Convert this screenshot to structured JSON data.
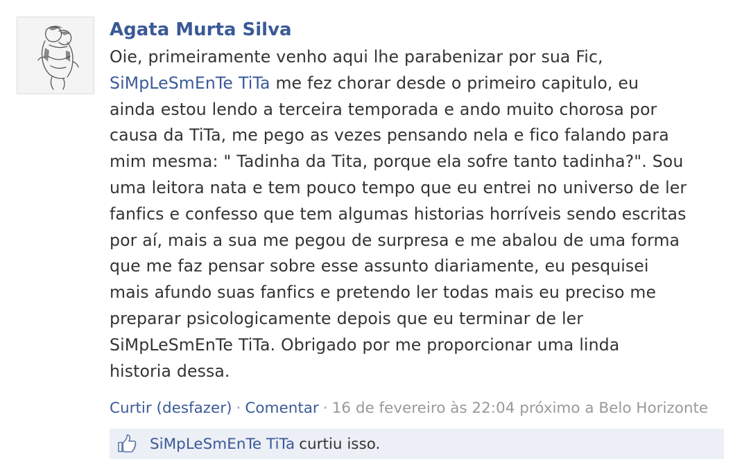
{
  "post": {
    "author": "Agata Murta Silva",
    "avatar_icon": "sketch-couple-hug-avatar",
    "message_lines": [
      [
        {
          "t": "Oie, primeiramente venho aqui lhe parabenizar por sua Fic,"
        }
      ],
      [
        {
          "t": "SiMpLeSmEnTe TiTa",
          "link": true
        },
        {
          "t": " me fez chorar desde o primeiro capitulo, eu"
        }
      ],
      [
        {
          "t": "ainda estou lendo a terceira temporada e ando muito chorosa por"
        }
      ],
      [
        {
          "t": "causa da TiTa, me pego as vezes pensando nela e fico falando para"
        }
      ],
      [
        {
          "t": "mim mesma: \" Tadinha da Tita, porque ela sofre tanto tadinha?\". Sou"
        }
      ],
      [
        {
          "t": "uma leitora nata e tem pouco tempo que eu entrei no universo de ler"
        }
      ],
      [
        {
          "t": "fanfics e confesso que tem algumas historias horríveis sendo escritas"
        }
      ],
      [
        {
          "t": "por aí, mais a sua me pegou de surpresa e me abalou de uma forma"
        }
      ],
      [
        {
          "t": "que me faz pensar sobre esse assunto diariamente, eu pesquisei"
        }
      ],
      [
        {
          "t": "mais afundo suas fanfics e pretendo ler todas mais eu preciso me"
        }
      ],
      [
        {
          "t": "preparar psicologicamente depois que eu terminar de ler"
        }
      ],
      [
        {
          "t": "SiMpLeSmEnTe TiTa. Obrigado por me proporcionar uma linda"
        }
      ],
      [
        {
          "t": "historia dessa."
        }
      ]
    ],
    "actions": {
      "like_label": "Curtir (desfazer)",
      "comment_label": "Comentar",
      "separator": "·",
      "timestamp": "16 de fevereiro às 22:04",
      "location": "próximo a Belo Horizonte"
    },
    "likes": {
      "icon": "thumbs-up-icon",
      "liker": "SiMpLeSmEnTe TiTa",
      "text": "curtiu isso."
    }
  },
  "colors": {
    "link": "#3b5998",
    "text": "#333333",
    "meta": "#999999",
    "like_box_bg": "#eceff5"
  }
}
